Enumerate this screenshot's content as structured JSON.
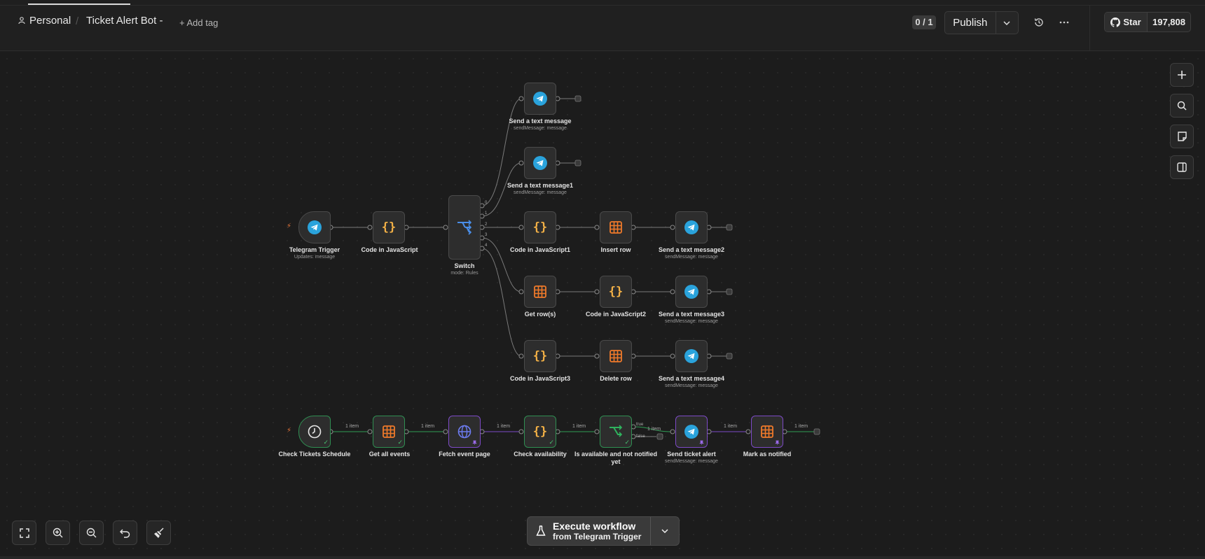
{
  "header": {
    "workspace": "Personal",
    "workflow_title": "Ticket Alert Bot -",
    "add_tag": "+ Add tag",
    "counter": "0 / 1",
    "publish_label": "Publish",
    "github_star": "Star",
    "github_count": "197,808"
  },
  "nodes": {
    "telegram_trigger": {
      "label": "Telegram Trigger",
      "sub": "Updates: message"
    },
    "code_js": {
      "label": "Code in JavaScript"
    },
    "switch": {
      "label": "Switch",
      "sub": "mode: Rules"
    },
    "send_text_1": {
      "label": "Send a text message",
      "sub": "sendMessage: message"
    },
    "send_text_2": {
      "label": "Send a text message1",
      "sub": "sendMessage: message"
    },
    "code_js1": {
      "label": "Code in JavaScript1"
    },
    "insert_row": {
      "label": "Insert row"
    },
    "send_text_3": {
      "label": "Send a text message2",
      "sub": "sendMessage: message"
    },
    "get_rows": {
      "label": "Get row(s)"
    },
    "code_js2": {
      "label": "Code in JavaScript2"
    },
    "send_text_4": {
      "label": "Send a text message3",
      "sub": "sendMessage: message"
    },
    "code_js3": {
      "label": "Code in JavaScript3"
    },
    "delete_row": {
      "label": "Delete row"
    },
    "send_text_5": {
      "label": "Send a text message4",
      "sub": "sendMessage: message"
    },
    "schedule": {
      "label": "Check Tickets Schedule"
    },
    "get_events": {
      "label": "Get all events"
    },
    "fetch_page": {
      "label": "Fetch event page"
    },
    "check_avail": {
      "label": "Check availability"
    },
    "is_available": {
      "label": "Is available and not notified yet"
    },
    "send_alert": {
      "label": "Send ticket alert",
      "sub": "sendMessage: message"
    },
    "mark_notified": {
      "label": "Mark as notified"
    }
  },
  "edge_labels": {
    "item": "1 item",
    "true": "true",
    "false": "false",
    "switch_ports": [
      "0",
      "1",
      "2",
      "3",
      "4"
    ]
  },
  "execute": {
    "title": "Execute workflow",
    "subtitle": "from Telegram Trigger"
  },
  "colors": {
    "telegram": "#2aa3dc",
    "code": "#f2b046",
    "table": "#f07a2a",
    "switch": "#4a8ee8",
    "http": "#6d7cf0",
    "if": "#2fb35e",
    "success": "#2f8f52",
    "pinned": "#7d4ac7"
  }
}
